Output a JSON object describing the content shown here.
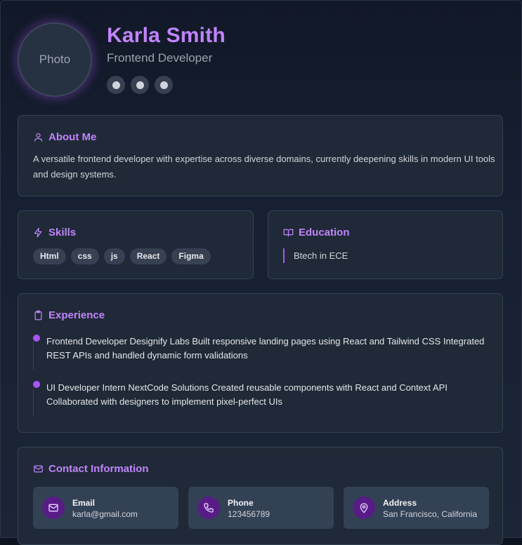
{
  "profile": {
    "photo_label": "Photo",
    "name": "Karla Smith",
    "role": "Frontend Developer",
    "socials": [
      "social-link-1",
      "social-link-2",
      "social-link-3"
    ]
  },
  "about": {
    "title": "About Me",
    "text": "A versatile frontend developer with expertise across diverse domains, currently deepening skills in modern UI tools and design systems."
  },
  "skills": {
    "title": "Skills",
    "items": [
      "Html",
      "css",
      "js",
      "React",
      "Figma"
    ]
  },
  "education": {
    "title": "Education",
    "items": [
      "Btech in ECE"
    ]
  },
  "experience": {
    "title": "Experience",
    "items": [
      "Frontend Developer Designify Labs Built responsive landing pages using React and Tailwind CSS Integrated REST APIs and handled dynamic form validations",
      "UI Developer Intern NextCode Solutions Created reusable components with React and Context API Collaborated with designers to implement pixel-perfect UIs"
    ]
  },
  "contact": {
    "title": "Contact Information",
    "items": [
      {
        "label": "Email",
        "value": "karla@gmail.com",
        "icon": "mail-icon"
      },
      {
        "label": "Phone",
        "value": "123456789",
        "icon": "phone-icon"
      },
      {
        "label": "Address",
        "value": "San Francisco, California",
        "icon": "map-pin-icon"
      }
    ]
  },
  "colors": {
    "accent": "#c084fc",
    "accent_dark": "#581c87",
    "card_bg": "#1f2937"
  }
}
